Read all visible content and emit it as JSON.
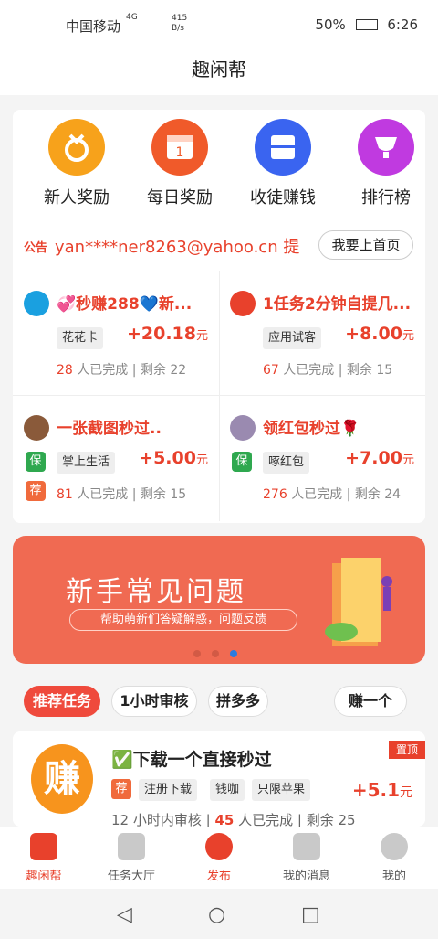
{
  "status": {
    "carrier": "中国移动",
    "net_speed": "415 B/s",
    "battery": "50%",
    "time": "6:26",
    "network": "4G"
  },
  "app": {
    "title": "趣闲帮"
  },
  "quick": [
    {
      "label": "新人奖励",
      "color": "#f7a21b",
      "icon": "medal-icon"
    },
    {
      "label": "每日奖励",
      "color": "#f05a2a",
      "icon": "calendar-icon"
    },
    {
      "label": "收徒赚钱",
      "color": "#3a64f0",
      "icon": "box-icon"
    },
    {
      "label": "排行榜",
      "color": "#c03ae0",
      "icon": "trophy-icon"
    }
  ],
  "notice": {
    "tag": "公告",
    "text": "yan****ner8263@yahoo.cn 提",
    "button": "我要上首页"
  },
  "tasks": [
    {
      "title": "💞秒赚288💙新...",
      "chip": "花花卡",
      "price": "+20.18",
      "unit": "元",
      "done": "28",
      "done_label": "人已完成",
      "remain": "剩余 22",
      "badge": "",
      "badge2": ""
    },
    {
      "title": "1任务2分钟自提几...",
      "chip": "应用试客",
      "price": "+8.00",
      "unit": "元",
      "done": "67",
      "done_label": "人已完成",
      "remain": "剩余 15",
      "badge": "",
      "badge2": ""
    },
    {
      "title": "一张截图秒过..",
      "chip": "掌上生活",
      "price": "+5.00",
      "unit": "元",
      "done": "81",
      "done_label": "人已完成",
      "remain": "剩余 15",
      "badge": "保",
      "badge2": "荐"
    },
    {
      "title": "领红包秒过🌹",
      "chip": "啄红包",
      "price": "+7.00",
      "unit": "元",
      "done": "276",
      "done_label": "人已完成",
      "remain": "剩余 24",
      "badge": "保",
      "badge2": ""
    }
  ],
  "banner": {
    "title": "新手常见问题",
    "subtitle": "帮助萌新们答疑解惑，问题反馈"
  },
  "tabs": [
    "推荐任务",
    "1小时审核",
    "拼多多",
    "赚一个"
  ],
  "list": [
    {
      "title": "✅下载一个直接秒过",
      "ribbon": "置顶",
      "badge": "荐",
      "chips": [
        "注册下载",
        "钱咖",
        "只限苹果"
      ],
      "price": "+5.1",
      "unit": "元",
      "review": "12 小时内审核",
      "done": "45",
      "done_label": "人已完成",
      "remain": "剩余 25",
      "logo": "赚"
    }
  ],
  "nav": [
    "趣闲帮",
    "任务大厅",
    "发布",
    "我的消息",
    "我的"
  ]
}
